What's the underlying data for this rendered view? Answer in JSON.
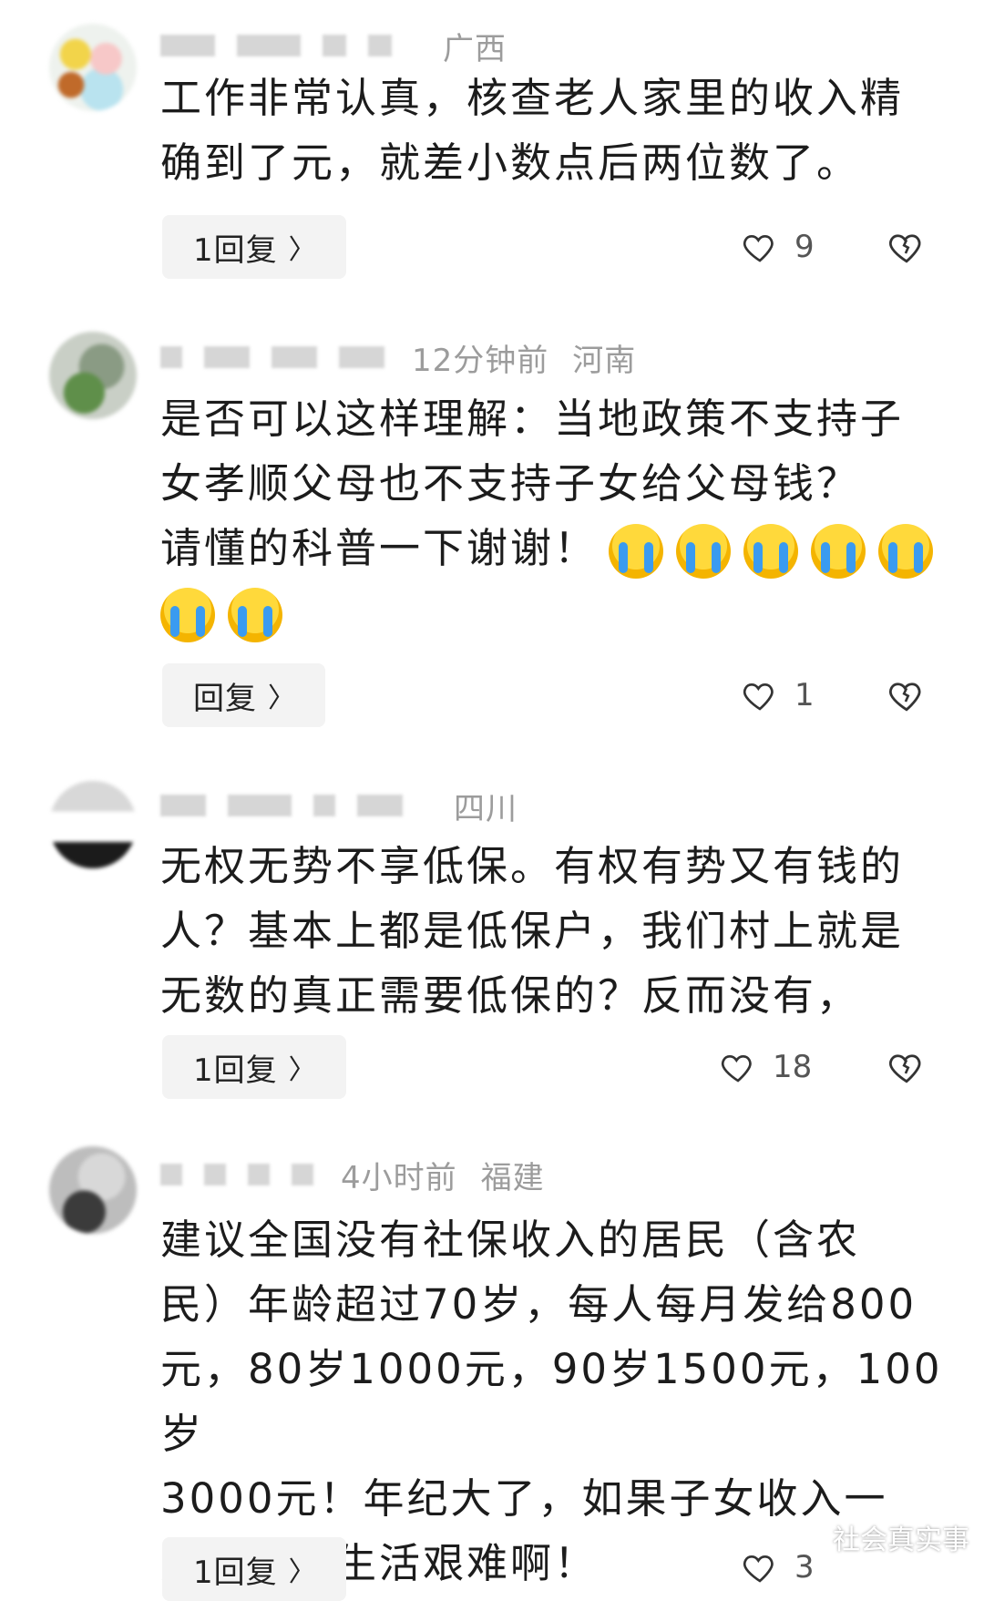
{
  "comments": [
    {
      "time": "",
      "location": "广西",
      "text_lines": [
        "工作非常认真，核查老人家里的收入精",
        "确到了元，就差小数点后两位数了。"
      ],
      "reply_label": "1回复",
      "likes": "9"
    },
    {
      "time": "12分钟前",
      "location": "河南",
      "text_lines": [
        "是否可以这样理解：当地政策不支持子",
        "女孝顺父母也不支持子女给父母钱？",
        "请懂的科普一下谢谢！"
      ],
      "emoji_count": 7,
      "reply_label": "回复",
      "likes": "1"
    },
    {
      "time": "",
      "location": "四川",
      "text_lines": [
        "无权无势不享低保。有权有势又有钱的",
        "人？基本上都是低保户，我们村上就是",
        "无数的真正需要低保的？反而没有，"
      ],
      "reply_label": "1回复",
      "likes": "18"
    },
    {
      "time": "4小时前",
      "location": "福建",
      "text_lines": [
        "建议全国没有社保收入的居民（含农",
        "民）年龄超过70岁，每人每月发给800",
        "元，80岁1000元，90岁1500元，100岁",
        "3000元！年纪大了，如果子女收入一",
        "般，老人生活艰难啊！"
      ],
      "reply_label": "1回复",
      "likes": "3"
    }
  ],
  "icons": {
    "like": "heart-outline-icon",
    "dislike": "broken-heart-icon",
    "reply_chevron": "chevron-right-icon",
    "emoji": "loudly-crying-face-emoji"
  },
  "watermark": "社会真实事"
}
